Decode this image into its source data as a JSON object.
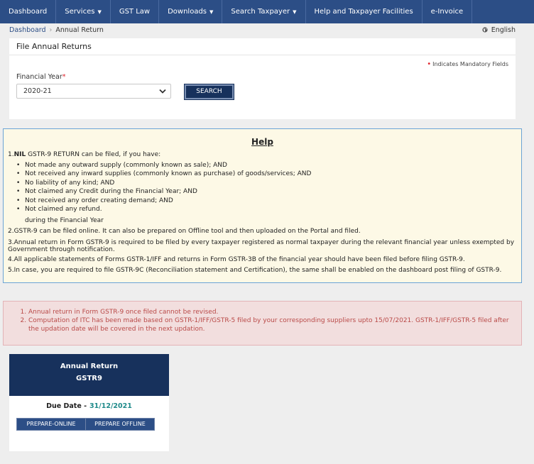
{
  "nav": {
    "items": [
      {
        "label": "Dashboard",
        "dropdown": false
      },
      {
        "label": "Services",
        "dropdown": true
      },
      {
        "label": "GST Law",
        "dropdown": false
      },
      {
        "label": "Downloads",
        "dropdown": true
      },
      {
        "label": "Search Taxpayer",
        "dropdown": true
      },
      {
        "label": "Help and Taxpayer Facilities",
        "dropdown": false
      },
      {
        "label": "e-Invoice",
        "dropdown": false
      }
    ],
    "caret": "▼"
  },
  "breadcrumb": {
    "home": "Dashboard",
    "separator": "›",
    "current": "Annual Return"
  },
  "language": {
    "label": "English",
    "icon": "globe-icon"
  },
  "file_panel": {
    "title": "File Annual Returns",
    "mandatory_note": "Indicates Mandatory Fields",
    "financial_year_label": "Financial Year",
    "required_mark": "*",
    "financial_year_value": "2020-21",
    "search_label": "SEARCH"
  },
  "help": {
    "title": "Help",
    "item1_num": "1.",
    "item1_bold": "NIL",
    "item1_rest": " GSTR-9 RETURN can be filed, if you have:",
    "bullets": [
      "Not made any outward supply (commonly known as sale); AND",
      "Not received any inward supplies (commonly known as purchase) of goods/services; AND",
      "No liability of any kind; AND",
      "Not claimed any Credit during the Financial Year; AND",
      "Not received any order creating demand; AND",
      "Not claimed any refund."
    ],
    "during_fy": "during the Financial Year",
    "item2": "2.GSTR-9 can be filed online. It can also be prepared on Offline tool and then uploaded on the Portal and filed.",
    "item3": "3.Annual return in Form GSTR-9 is required to be filed by every taxpayer registered as normal taxpayer during the relevant financial year unless exempted by Government through notification.",
    "item4": "4.All applicable statements of Forms GSTR-1/IFF and returns in Form GSTR-3B of the financial year should have been filed before filing GSTR-9.",
    "item5": "5.In case, you are required to file GSTR-9C (Reconciliation statement and Certification), the same shall be enabled on the dashboard post filing of GSTR-9."
  },
  "notice": {
    "items": [
      "Annual return in Form GSTR-9 once filed cannot be revised.",
      "Computation of ITC has been made based on GSTR-1/IFF/GSTR-5 filed by your corresponding suppliers upto 15/07/2021. GSTR-1/IFF/GSTR-5 filed after the updation date will be covered in the next updation."
    ]
  },
  "return_card": {
    "title": "Annual Return",
    "form": "GSTR9",
    "due_label": "Due Date -",
    "due_date": "31/12/2021",
    "prepare_online": "PREPARE-ONLINE",
    "prepare_offline": "PREPARE OFFLINE"
  },
  "colors": {
    "nav_bg": "#2c4e86",
    "dark_blue": "#17315c",
    "help_bg": "#fdf9e6",
    "notice_bg": "#f2dede",
    "notice_text": "#b94a48",
    "due_date": "#1f8a8a",
    "required": "#e0232b"
  }
}
